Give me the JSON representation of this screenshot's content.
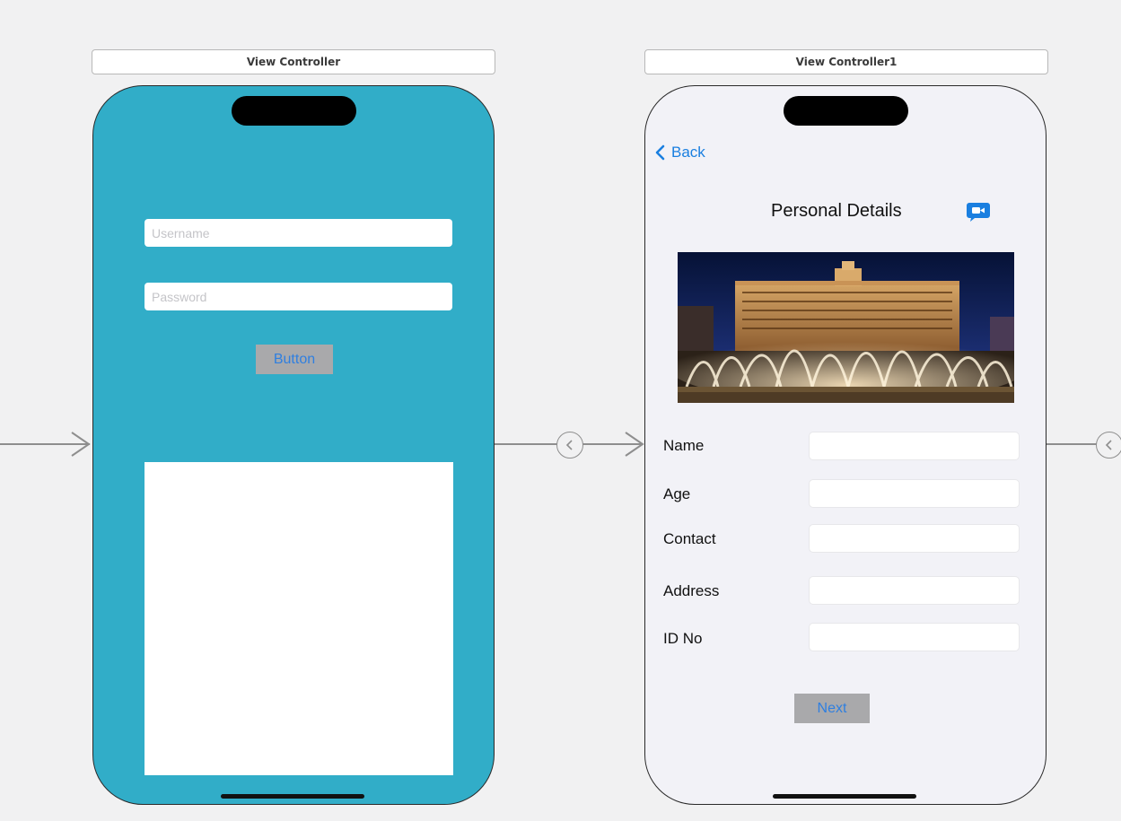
{
  "scenes": [
    {
      "title": "View Controller",
      "username_placeholder": "Username",
      "password_placeholder": "Password",
      "button_label": "Button",
      "background_color": "#31adc8"
    },
    {
      "title": "View Controller1",
      "back_label": "Back",
      "page_title": "Personal Details",
      "fields": [
        {
          "label": "Name"
        },
        {
          "label": "Age"
        },
        {
          "label": "Contact"
        },
        {
          "label": "Address"
        },
        {
          "label": "ID No"
        }
      ],
      "next_label": "Next",
      "tint_color": "#1a7fe0"
    }
  ],
  "icons": {
    "back": "chevron-left-icon",
    "video": "video-camera-bubble-icon",
    "segue": "segue-chevron-left-icon"
  }
}
